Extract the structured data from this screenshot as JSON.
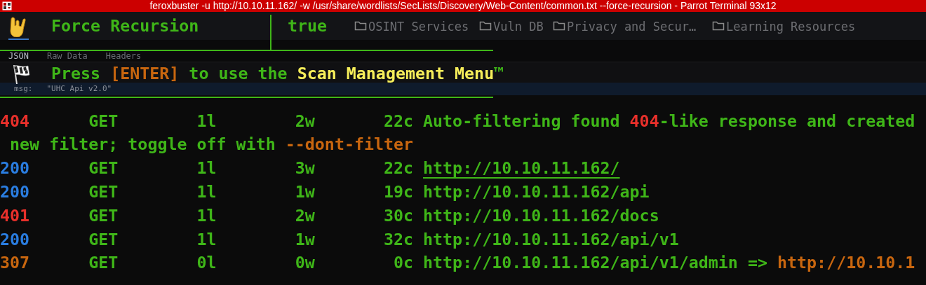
{
  "window": {
    "title": "feroxbuster -u http://10.10.11.162/ -w /usr/share/wordlists/SecLists/Discovery/Web-Content/common.txt --force-recursion - Parrot Terminal 93x12"
  },
  "browser_background": {
    "bookmarks": [
      {
        "label": "OSINT Services"
      },
      {
        "label": "Vuln DB"
      },
      {
        "label": "Privacy and Secur…"
      },
      {
        "label": "Learning Resources"
      }
    ],
    "tabs": [
      {
        "label": "JSON",
        "selected": true
      },
      {
        "label": "Raw Data",
        "selected": false
      },
      {
        "label": "Headers",
        "selected": false
      }
    ],
    "json_row": {
      "key": "msg:",
      "value": "\"UHC Api v2.0\""
    }
  },
  "banner": {
    "setting": {
      "label": "Force Recursion",
      "value": "true"
    },
    "prompt": [
      {
        "text": "Press ",
        "kind": "plain"
      },
      {
        "text": "[ENTER]",
        "kind": "key"
      },
      {
        "text": " to use the ",
        "kind": "plain"
      },
      {
        "text": "Scan Management Menu",
        "kind": "highlight"
      },
      {
        "text": "™",
        "kind": "plain"
      }
    ]
  },
  "lines": [
    {
      "kind": "result",
      "status": "404",
      "color": "#e8302b",
      "method": "GET",
      "lines": "1l",
      "words": "2w",
      "chars": "22c",
      "message": [
        {
          "text": "Auto-filtering found ",
          "kind": "plain"
        },
        {
          "text": "404",
          "kind": "error"
        },
        {
          "text": "-like response and created",
          "kind": "plain"
        }
      ]
    },
    {
      "kind": "continuation",
      "message": [
        {
          "text": " new filter; toggle off with ",
          "kind": "plain"
        },
        {
          "text": "--dont-filter",
          "kind": "option"
        }
      ]
    },
    {
      "kind": "result",
      "status": "200",
      "color": "#2a7de0",
      "method": "GET",
      "lines": "1l",
      "words": "3w",
      "chars": "22c",
      "url": "http://10.10.11.162/",
      "underlined": true
    },
    {
      "kind": "result",
      "status": "200",
      "color": "#2a7de0",
      "method": "GET",
      "lines": "1l",
      "words": "1w",
      "chars": "19c",
      "url": "http://10.10.11.162/api",
      "underlined": false
    },
    {
      "kind": "result",
      "status": "401",
      "color": "#e8302b",
      "method": "GET",
      "lines": "1l",
      "words": "2w",
      "chars": "30c",
      "url": "http://10.10.11.162/docs",
      "underlined": false
    },
    {
      "kind": "result",
      "status": "200",
      "color": "#2a7de0",
      "method": "GET",
      "lines": "1l",
      "words": "1w",
      "chars": "32c",
      "url": "http://10.10.11.162/api/v1",
      "underlined": false
    },
    {
      "kind": "result",
      "status": "307",
      "color": "#c8660f",
      "method": "GET",
      "lines": "0l",
      "words": "0w",
      "chars": "0c",
      "url": "http://10.10.11.162/api/v1/admin",
      "arrow": " => ",
      "redirect": "http://10.10.1",
      "underlined": false
    }
  ]
}
